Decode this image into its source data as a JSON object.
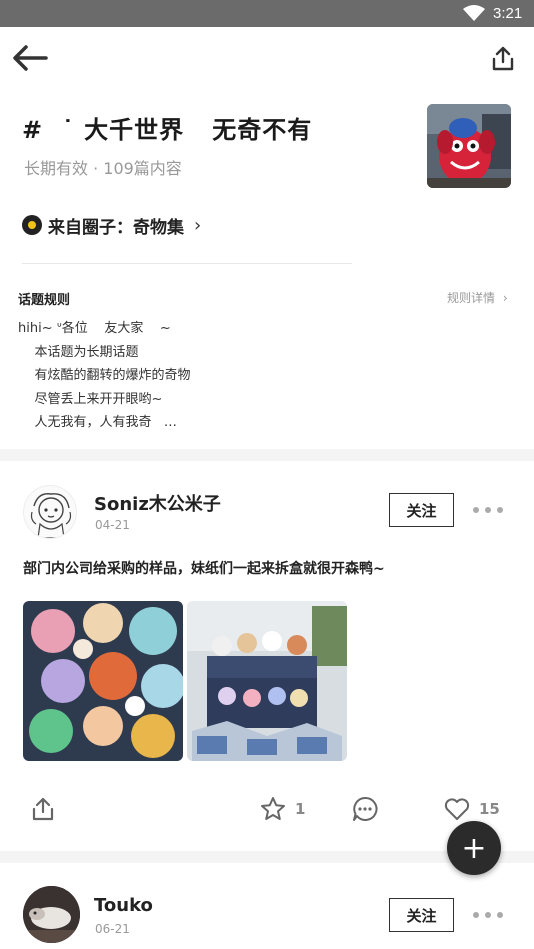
{
  "status_bar": {
    "time": "3:21"
  },
  "topic": {
    "title": "#  ˙ 大千世界   无奇不有",
    "meta": "长期有效 · 109篇内容",
    "circle_link": "来自圈子：奇物集"
  },
  "rules": {
    "heading": "话题规则",
    "detail_link": "规则详情",
    "body": "hihi~ ᐡ各位    友大家    ~\n    本话题为长期话题\n    有炫酷的翻转的爆炸的奇物\n    尽管丢上来开开眼哟~\n    人无我有，人有我奇   …"
  },
  "posts": [
    {
      "user": "Soniz木公米子",
      "date": "04-21",
      "follow_label": "关注",
      "text": "部门内公司给采购的样品，妹纸们一起来拆盒就很开森鸭~",
      "star_count": "1",
      "like_count": "15"
    },
    {
      "user": "Touko",
      "date": "06-21",
      "follow_label": "关注"
    }
  ],
  "fab_label": "+",
  "icons": [
    "wifi-icon",
    "back-arrow-icon",
    "share-icon",
    "chevron-right-icon",
    "star-icon",
    "comment-icon",
    "heart-icon",
    "more-icon",
    "plus-icon"
  ]
}
